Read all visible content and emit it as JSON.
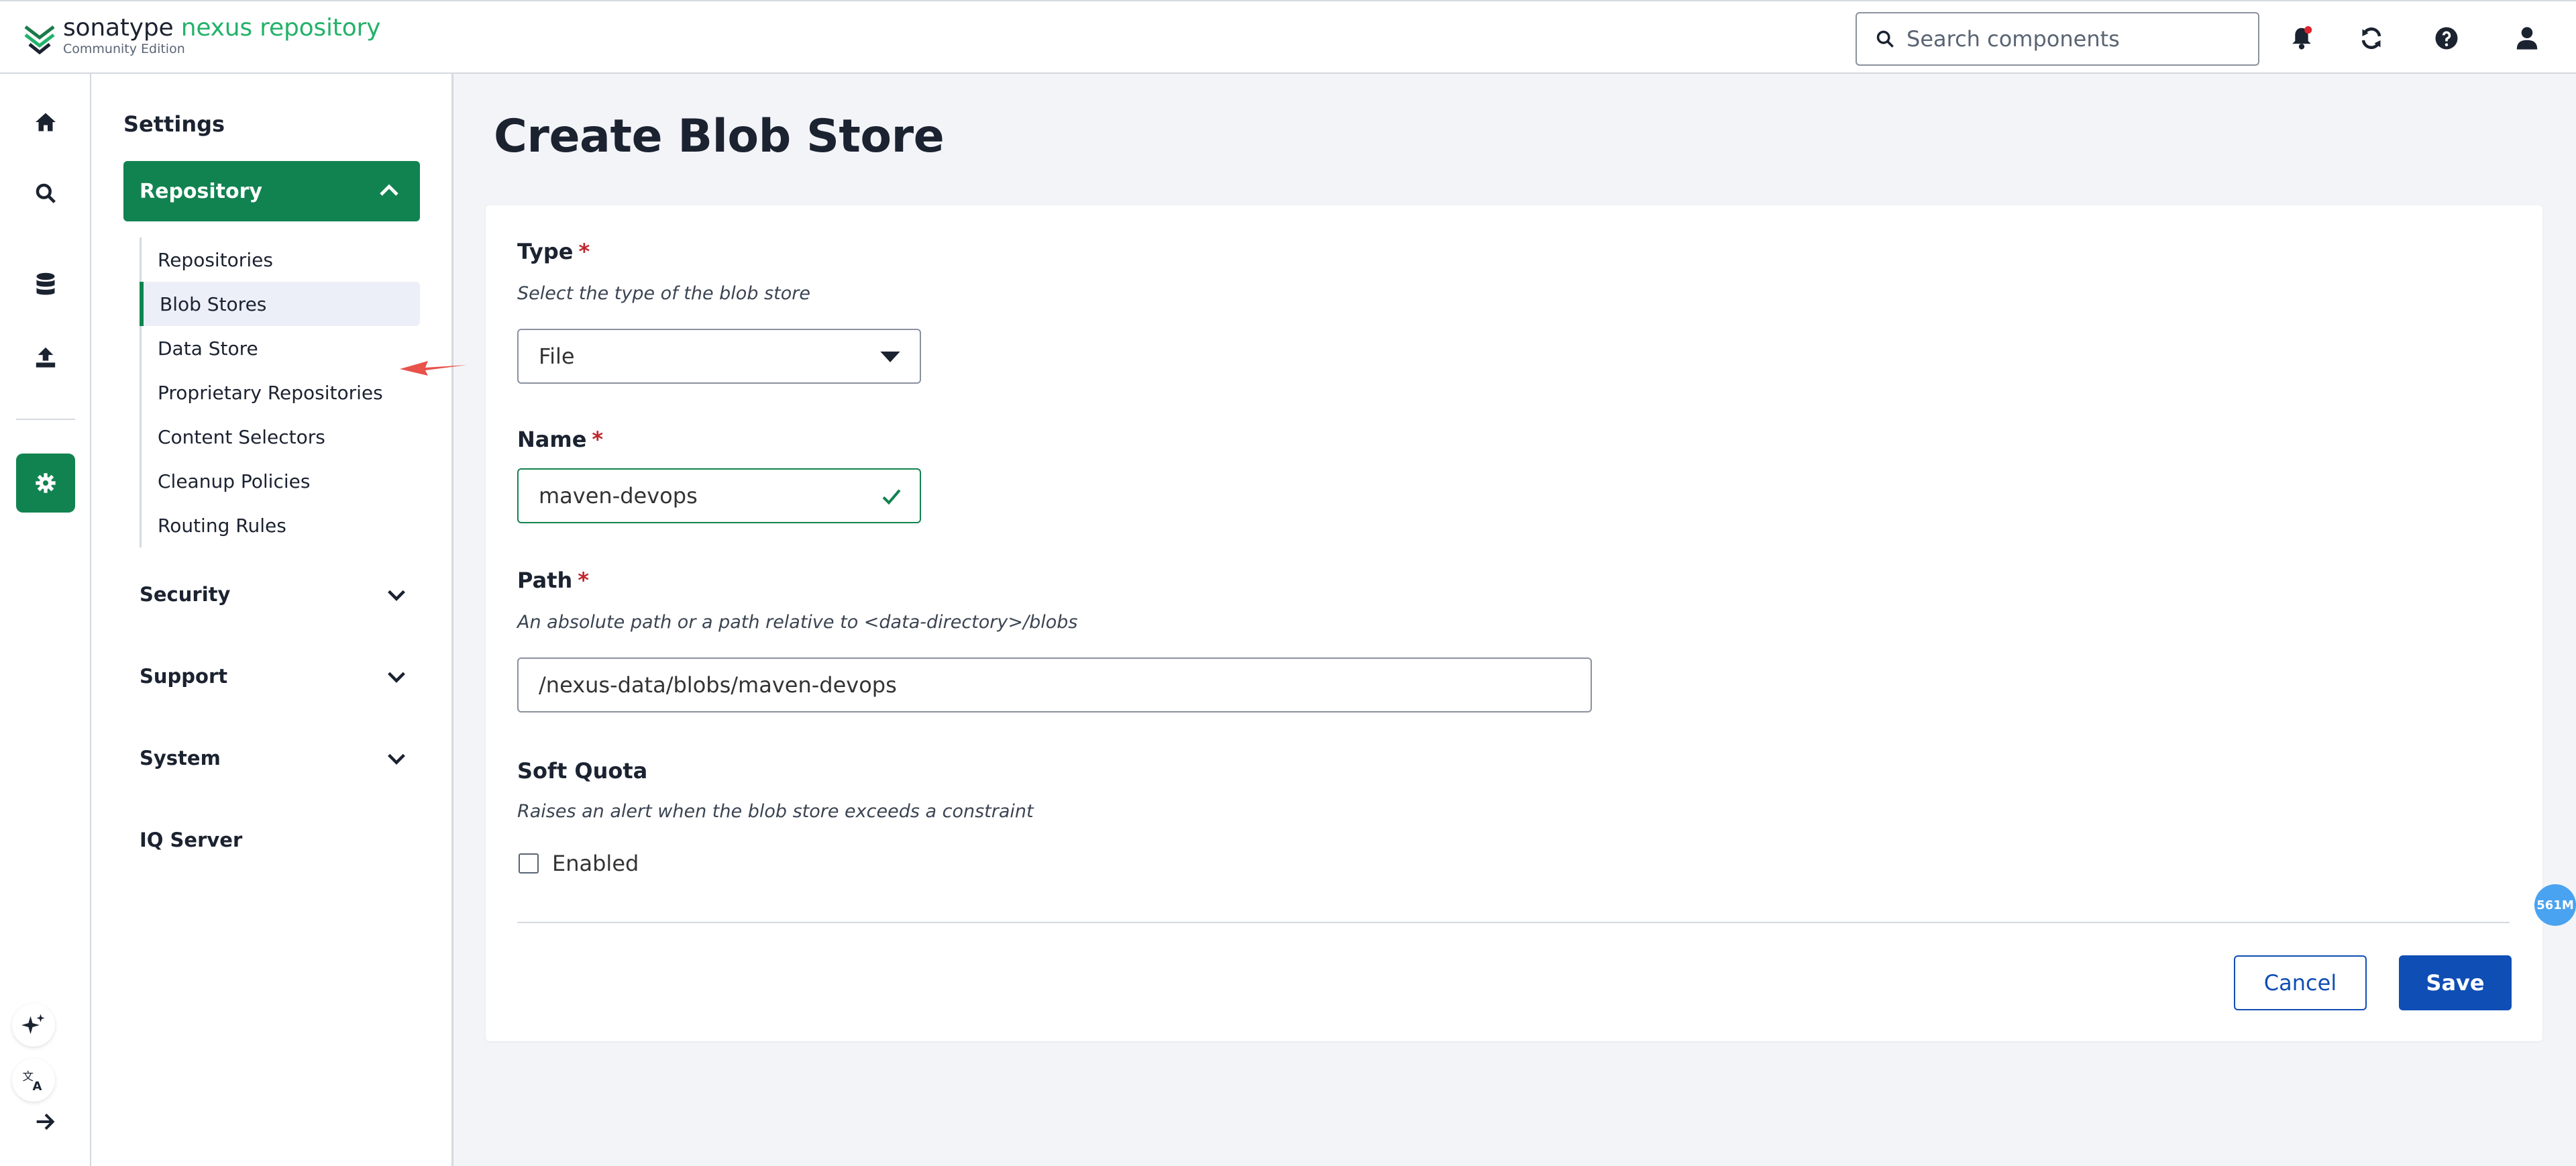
{
  "header": {
    "logo_brand": "sonatype",
    "logo_product": "nexus repository",
    "logo_edition": "Community Edition",
    "search_placeholder": "Search components",
    "icons": [
      "bell-icon",
      "refresh-icon",
      "help-icon",
      "user-icon"
    ],
    "notification_dot_color": "#e0242f"
  },
  "rail": {
    "icons": [
      "home-icon",
      "search-icon",
      "database-icon",
      "upload-icon",
      "gear-icon"
    ],
    "bottom_icons": [
      "sparkle-icon",
      "translate-icon",
      "arrow-right-icon"
    ]
  },
  "sidebar": {
    "title": "Settings",
    "repository_section": "Repository",
    "repository_items": [
      "Repositories",
      "Blob Stores",
      "Data Store",
      "Proprietary Repositories",
      "Content Selectors",
      "Cleanup Policies",
      "Routing Rules"
    ],
    "active_item": "Blob Stores",
    "sections": [
      "Security",
      "Support",
      "System",
      "IQ Server"
    ]
  },
  "form": {
    "title": "Create Blob Store",
    "type_label": "Type",
    "type_help": "Select the type of the blob store",
    "type_value": "File",
    "name_label": "Name",
    "name_value": "maven-devops",
    "path_label": "Path",
    "path_help": "An absolute path or a path relative to <data-directory>/blobs",
    "path_value": "/nexus-data/blobs/maven-devops",
    "quota_label": "Soft Quota",
    "quota_help": "Raises an alert when the blob store exceeds a constraint",
    "quota_checkbox_label": "Enabled",
    "required_mark": "*",
    "cancel_label": "Cancel",
    "save_label": "Save"
  },
  "memory_badge": "561M",
  "colors": {
    "primary_green": "#118350",
    "primary_blue": "#0f4eb5",
    "required_red": "#c0262d"
  }
}
